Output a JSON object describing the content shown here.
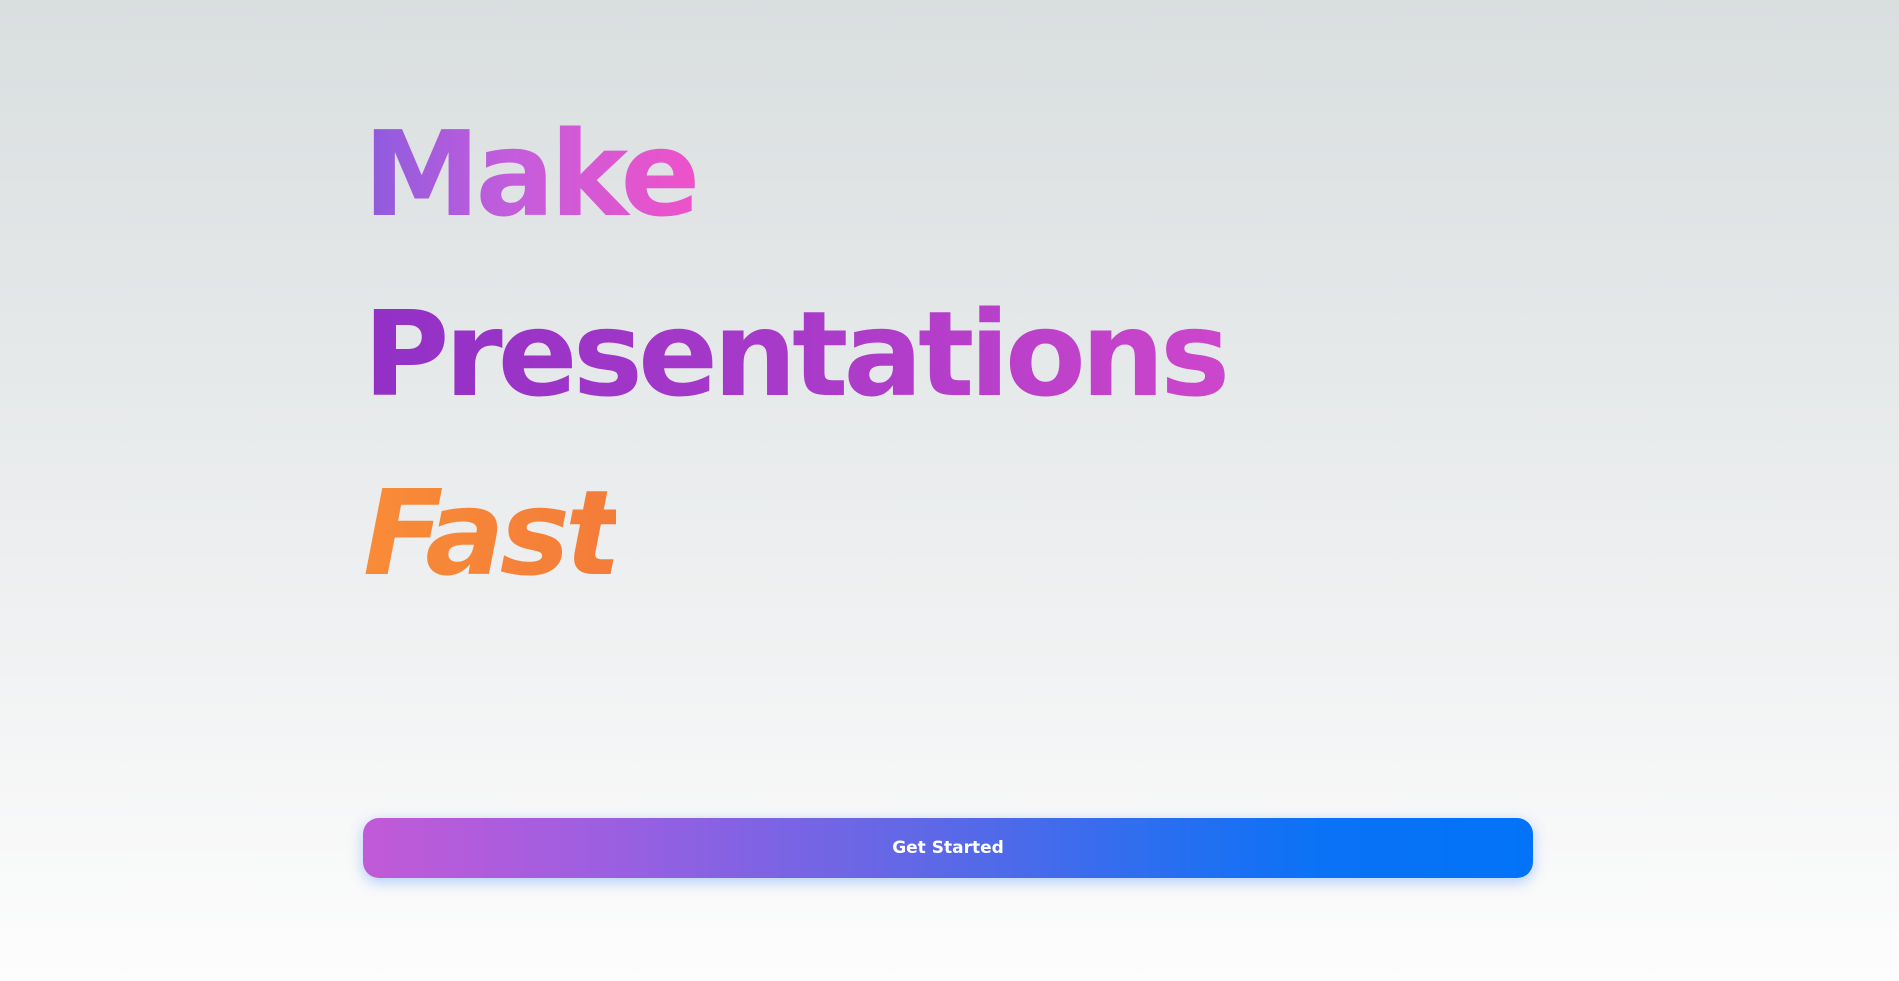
{
  "hero": {
    "line1": "Make",
    "line2": "Presentations",
    "line3": "Fast"
  },
  "cta": {
    "label": "Get Started"
  },
  "colors": {
    "make_gradient": [
      "#8d5bde",
      "#ee52c9"
    ],
    "presentations_gradient": [
      "#9230c6",
      "#cc46cb"
    ],
    "fast_gradient": [
      "#f88b38",
      "#f47d39"
    ],
    "button_gradient": [
      "#c25ad8",
      "#0273f7"
    ],
    "background": [
      "#d9dedf",
      "#fdfdfd"
    ]
  }
}
